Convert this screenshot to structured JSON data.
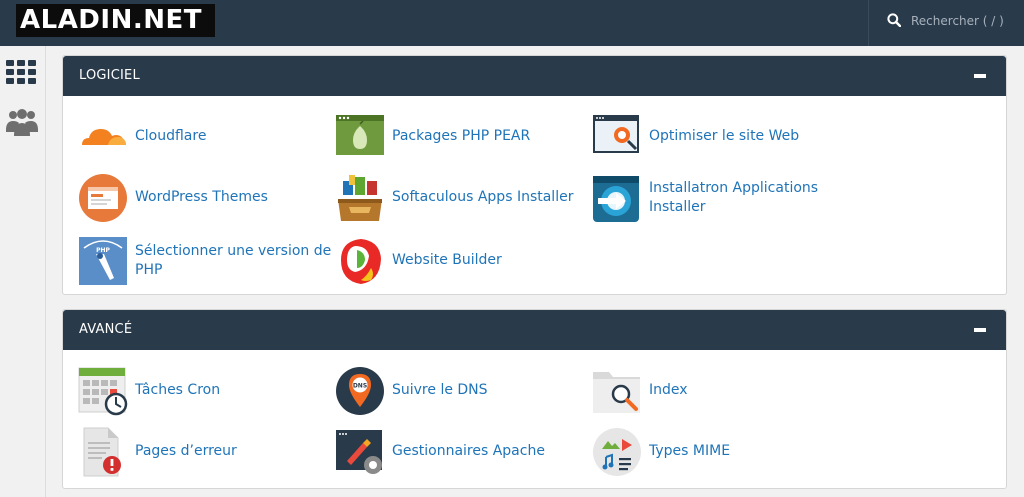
{
  "header": {
    "logo_text": "ALADIN.NET",
    "search_placeholder": "Rechercher ( / )"
  },
  "sidebar": {
    "items": [
      {
        "icon": "grid-icon"
      },
      {
        "icon": "users-icon"
      }
    ]
  },
  "sections": [
    {
      "title": "LOGICIEL",
      "items": [
        {
          "label": "Cloudflare",
          "icon": "cloudflare-icon"
        },
        {
          "label": "Packages PHP PEAR",
          "icon": "php-pear-icon"
        },
        {
          "label": "Optimiser le site Web",
          "icon": "optimize-website-icon"
        },
        {
          "label": "WordPress Themes",
          "icon": "wordpress-themes-icon"
        },
        {
          "label": "Softaculous Apps Installer",
          "icon": "softaculous-icon"
        },
        {
          "label_line1": "Installatron Applications",
          "label_line2": "Installer",
          "icon": "installatron-icon"
        },
        {
          "label_line1": "Sélectionner une version de",
          "label_line2": "PHP",
          "icon": "php-version-icon"
        },
        {
          "label": "Website Builder",
          "icon": "website-builder-icon"
        }
      ]
    },
    {
      "title": "AVANCÉ",
      "items": [
        {
          "label": "Tâches Cron",
          "icon": "cron-calendar-icon"
        },
        {
          "label": "Suivre le DNS",
          "icon": "dns-pin-icon"
        },
        {
          "label": "Index",
          "icon": "index-folder-icon"
        },
        {
          "label": "Pages d’erreur",
          "icon": "error-page-icon"
        },
        {
          "label": "Gestionnaires Apache",
          "icon": "apache-handlers-icon"
        },
        {
          "label": "Types MIME",
          "icon": "mime-types-icon"
        }
      ]
    }
  ],
  "colors": {
    "header_bg": "#293a4a",
    "link": "#1f74b8",
    "page_bg": "#f1f1f1"
  }
}
